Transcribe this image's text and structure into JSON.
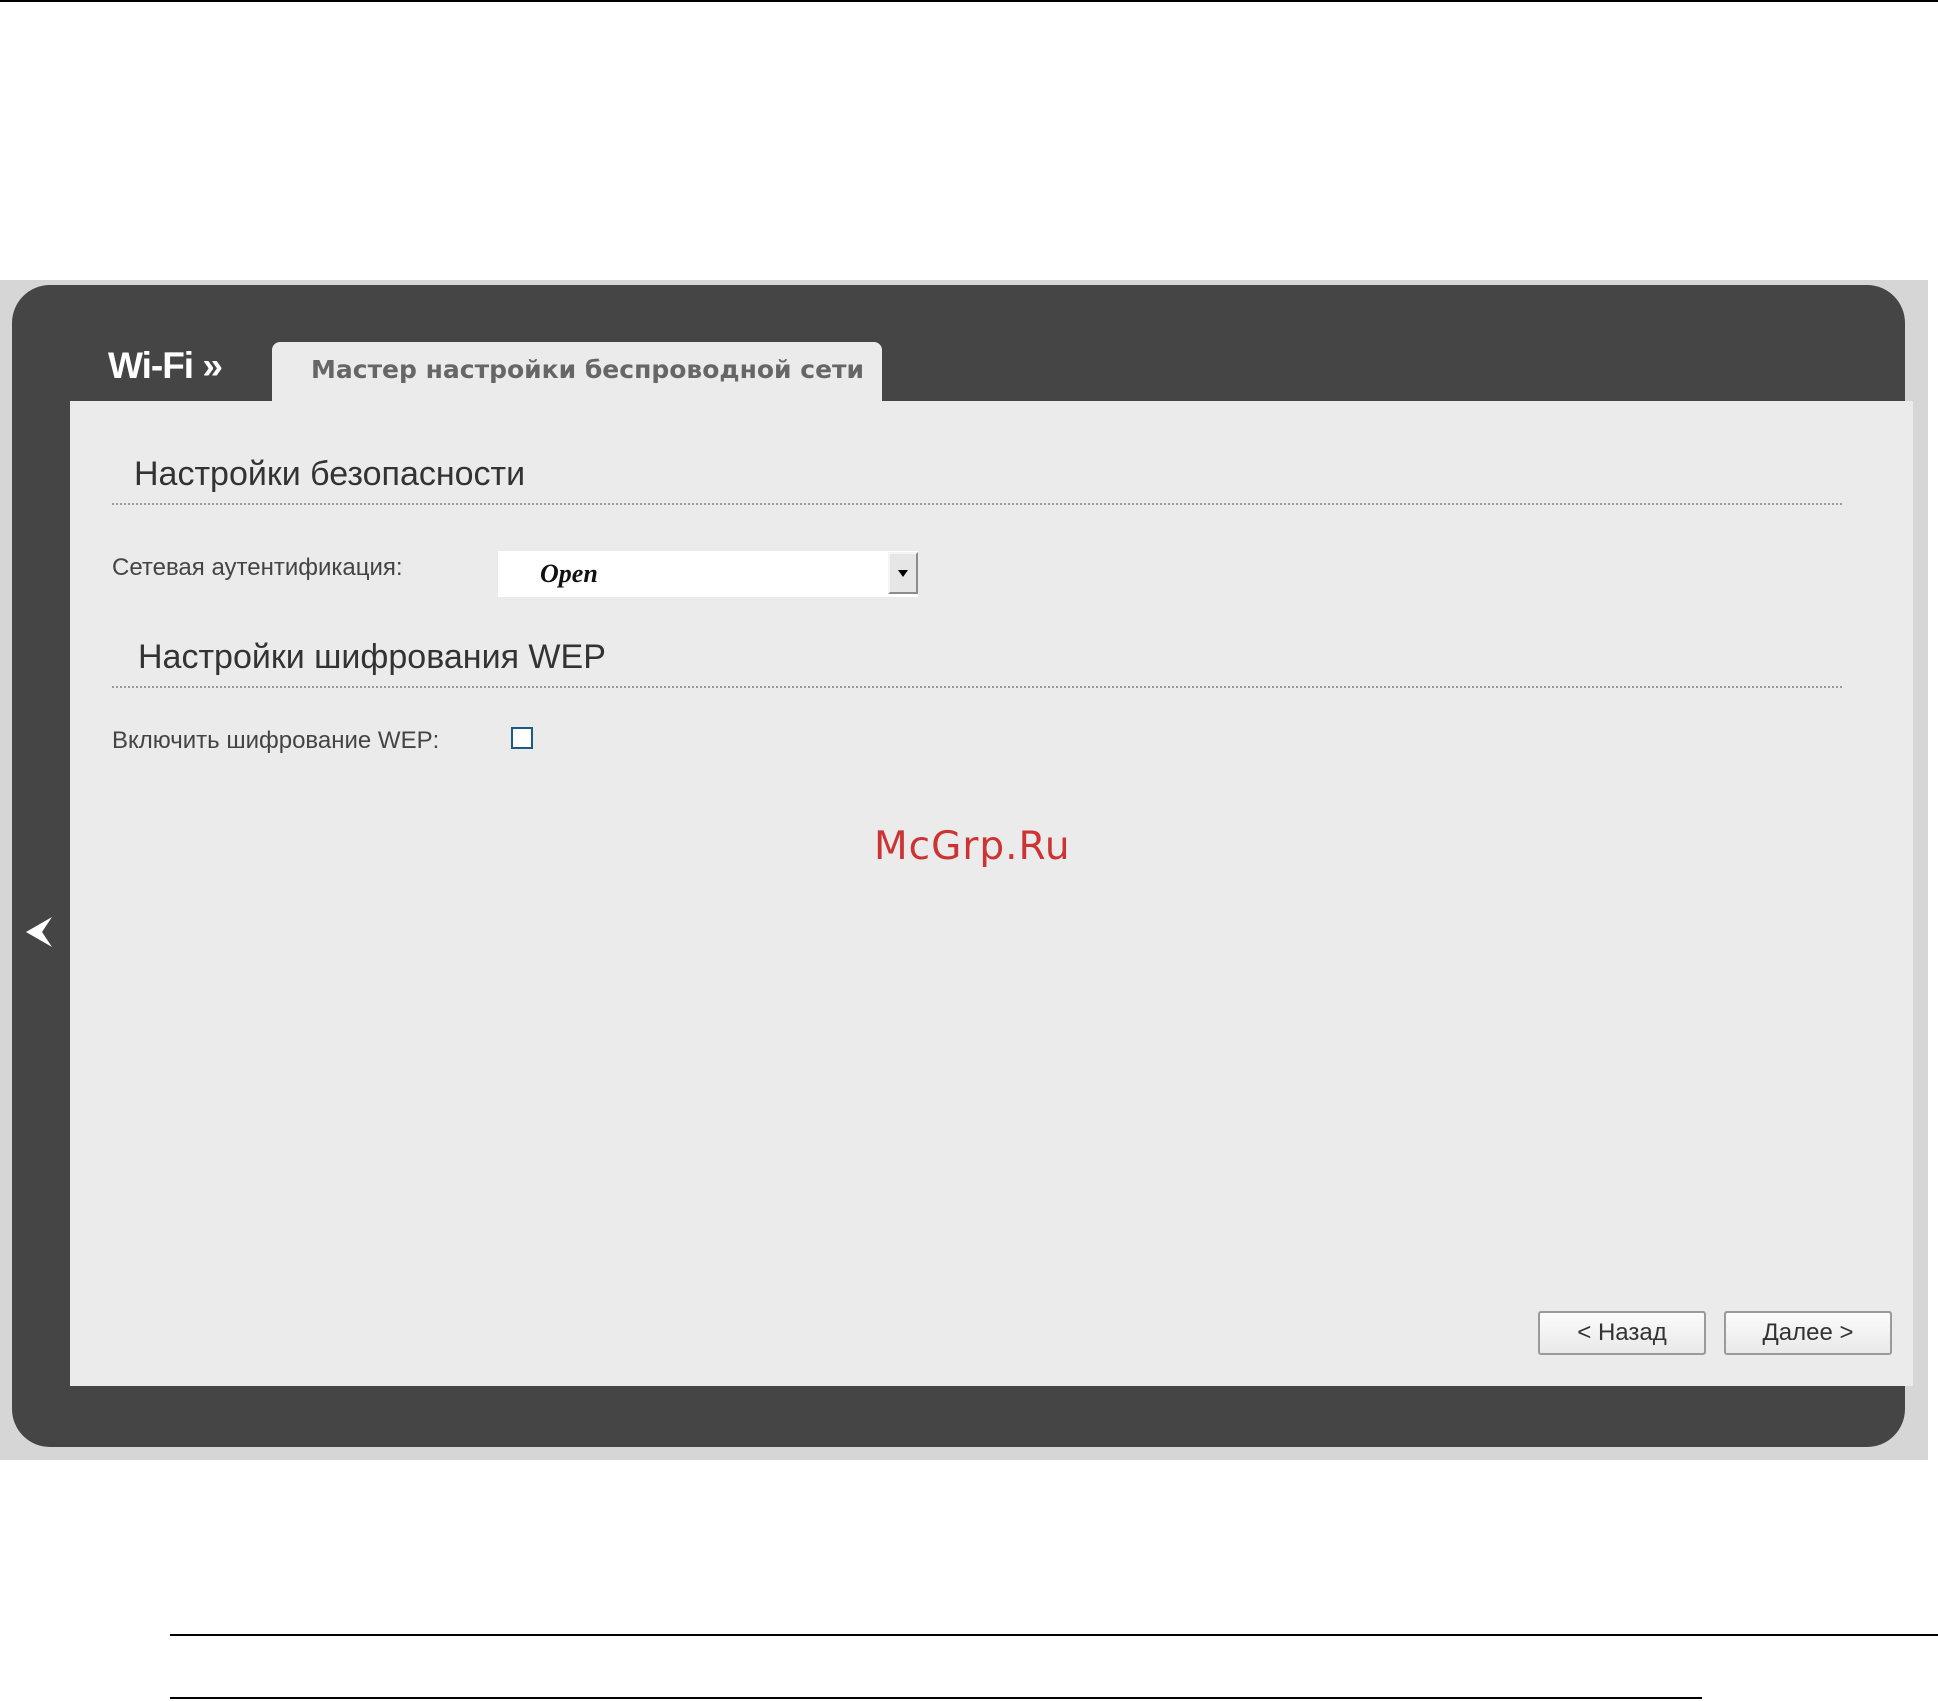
{
  "header": {
    "section_label": "Wi-Fi »",
    "active_tab": "Мастер настройки беспроводной сети"
  },
  "security": {
    "heading": "Настройки безопасности",
    "auth_label": "Сетевая аутентификация:",
    "auth_value": "Open"
  },
  "wep": {
    "heading": "Настройки шифрования WEP",
    "enable_label": "Включить шифрование WEP:",
    "enabled": false
  },
  "watermark": "McGrp.Ru",
  "buttons": {
    "back_label": "< Назад",
    "next_label": "Далее >"
  },
  "icons": {
    "sidebar_toggle": "chevron-left-icon",
    "dropdown": "triangle-down-icon"
  },
  "colors": {
    "panel": "#454545",
    "content": "#ebebeb",
    "checkbox_border": "#1c5a85",
    "watermark": "#cc3333"
  }
}
